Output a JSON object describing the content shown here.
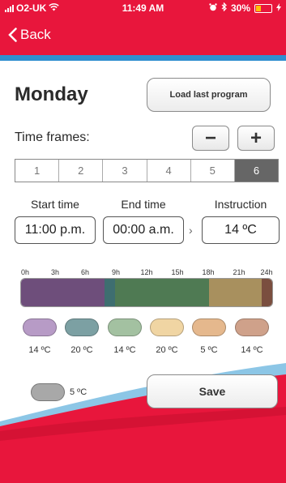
{
  "status": {
    "carrier": "O2-UK",
    "time": "11:49 AM",
    "battery": "30%"
  },
  "nav": {
    "back_label": "Back"
  },
  "day": "Monday",
  "load_button": "Load last program",
  "time_frames_label": "Time frames:",
  "stepper": {
    "minus": "−",
    "plus": "+"
  },
  "frames": [
    "1",
    "2",
    "3",
    "4",
    "5",
    "6"
  ],
  "selected_frame": "6",
  "headers": {
    "start": "Start time",
    "end": "End time",
    "instruction": "Instruction"
  },
  "fields": {
    "start": "11:00 p.m.",
    "end": "00:00 a.m.",
    "instruction": "14 ºC",
    "arrow": "›"
  },
  "timeline_ticks": [
    "0h",
    "3h",
    "6h",
    "9h",
    "12h",
    "15h",
    "18h",
    "21h",
    "24h"
  ],
  "timeline_segments": [
    {
      "from": 0,
      "to": 8,
      "color": "#6e4e7b"
    },
    {
      "from": 8,
      "to": 9,
      "color": "#3e6e70"
    },
    {
      "from": 9,
      "to": 18,
      "color": "#4f7a53"
    },
    {
      "from": 18,
      "to": 23,
      "color": "#a8905e"
    },
    {
      "from": 23,
      "to": 24,
      "color": "#7a4e3f"
    }
  ],
  "swatches": [
    {
      "label": "14 ºC",
      "color": "#b79bc6"
    },
    {
      "label": "20 ºC",
      "color": "#7ca0a3"
    },
    {
      "label": "14 ºC",
      "color": "#a3c1a1"
    },
    {
      "label": "20 ºC",
      "color": "#f0d5a3"
    },
    {
      "label": "5 ºC",
      "color": "#e5b88d"
    },
    {
      "label": "14 ºC",
      "color": "#cfa18a"
    }
  ],
  "off_swatch_label": "5 ºC",
  "save_button": "Save",
  "colors": {
    "brand_red": "#e8163c",
    "accent_blue": "#2f8fd0"
  }
}
